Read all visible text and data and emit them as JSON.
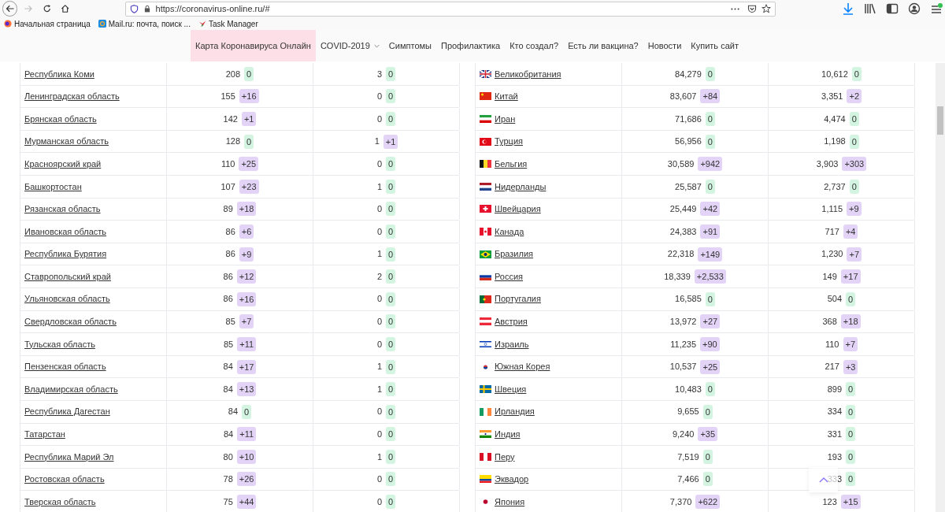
{
  "browser": {
    "url": "https://coronavirus-online.ru/#",
    "forward_disabled": true,
    "bookmarks": [
      "Начальная страница",
      "Mail.ru: почта, поиск ...",
      "Task Manager"
    ]
  },
  "nav": [
    {
      "label": "Карта Коронавируса Онлайн",
      "selected": true,
      "dropdown": false
    },
    {
      "label": "COVID-2019",
      "selected": false,
      "dropdown": true
    },
    {
      "label": "Симптомы",
      "selected": false,
      "dropdown": false
    },
    {
      "label": "Профилактика",
      "selected": false,
      "dropdown": false
    },
    {
      "label": "Кто создал?",
      "selected": false,
      "dropdown": false
    },
    {
      "label": "Есть ли вакцина?",
      "selected": false,
      "dropdown": false
    },
    {
      "label": "Новости",
      "selected": false,
      "dropdown": false
    },
    {
      "label": "Купить сайт",
      "selected": false,
      "dropdown": false
    }
  ],
  "tables": [
    {
      "rows": [
        {
          "name": "Республика Коми",
          "cases": {
            "value": "208",
            "delta": "0",
            "rising": false
          },
          "deaths": {
            "value": "3",
            "delta": "0",
            "rising": false
          }
        },
        {
          "name": "Ленинградская область",
          "cases": {
            "value": "155",
            "delta": "+16",
            "rising": true
          },
          "deaths": {
            "value": "0",
            "delta": "0",
            "rising": false
          }
        },
        {
          "name": "Брянская область",
          "cases": {
            "value": "142",
            "delta": "+1",
            "rising": true
          },
          "deaths": {
            "value": "0",
            "delta": "0",
            "rising": false
          }
        },
        {
          "name": "Мурманская область",
          "cases": {
            "value": "128",
            "delta": "0",
            "rising": false
          },
          "deaths": {
            "value": "1",
            "delta": "+1",
            "rising": true
          }
        },
        {
          "name": "Красноярский край",
          "cases": {
            "value": "110",
            "delta": "+25",
            "rising": true
          },
          "deaths": {
            "value": "0",
            "delta": "0",
            "rising": false
          }
        },
        {
          "name": "Башкортостан",
          "cases": {
            "value": "107",
            "delta": "+23",
            "rising": true
          },
          "deaths": {
            "value": "1",
            "delta": "0",
            "rising": false
          }
        },
        {
          "name": "Рязанская область",
          "cases": {
            "value": "89",
            "delta": "+18",
            "rising": true
          },
          "deaths": {
            "value": "0",
            "delta": "0",
            "rising": false
          }
        },
        {
          "name": "Ивановская область",
          "cases": {
            "value": "86",
            "delta": "+6",
            "rising": true
          },
          "deaths": {
            "value": "0",
            "delta": "0",
            "rising": false
          }
        },
        {
          "name": "Республика Бурятия",
          "cases": {
            "value": "86",
            "delta": "+9",
            "rising": true
          },
          "deaths": {
            "value": "1",
            "delta": "0",
            "rising": false
          }
        },
        {
          "name": "Ставропольский край",
          "cases": {
            "value": "86",
            "delta": "+12",
            "rising": true
          },
          "deaths": {
            "value": "2",
            "delta": "0",
            "rising": false
          }
        },
        {
          "name": "Ульяновская область",
          "cases": {
            "value": "86",
            "delta": "+16",
            "rising": true
          },
          "deaths": {
            "value": "0",
            "delta": "0",
            "rising": false
          }
        },
        {
          "name": "Свердловская область",
          "cases": {
            "value": "85",
            "delta": "+7",
            "rising": true
          },
          "deaths": {
            "value": "0",
            "delta": "0",
            "rising": false
          }
        },
        {
          "name": "Тульская область",
          "cases": {
            "value": "85",
            "delta": "+11",
            "rising": true
          },
          "deaths": {
            "value": "0",
            "delta": "0",
            "rising": false
          }
        },
        {
          "name": "Пензенская область",
          "cases": {
            "value": "84",
            "delta": "+17",
            "rising": true
          },
          "deaths": {
            "value": "1",
            "delta": "0",
            "rising": false
          }
        },
        {
          "name": "Владимирская область",
          "cases": {
            "value": "84",
            "delta": "+13",
            "rising": true
          },
          "deaths": {
            "value": "1",
            "delta": "0",
            "rising": false
          }
        },
        {
          "name": "Республика Дагестан",
          "cases": {
            "value": "84",
            "delta": "0",
            "rising": false
          },
          "deaths": {
            "value": "0",
            "delta": "0",
            "rising": false
          }
        },
        {
          "name": "Татарстан",
          "cases": {
            "value": "84",
            "delta": "+11",
            "rising": true
          },
          "deaths": {
            "value": "0",
            "delta": "0",
            "rising": false
          }
        },
        {
          "name": "Республика Марий Эл",
          "cases": {
            "value": "80",
            "delta": "+10",
            "rising": true
          },
          "deaths": {
            "value": "1",
            "delta": "0",
            "rising": false
          }
        },
        {
          "name": "Ростовская область",
          "cases": {
            "value": "78",
            "delta": "+26",
            "rising": true
          },
          "deaths": {
            "value": "0",
            "delta": "0",
            "rising": false
          }
        },
        {
          "name": "Тверская область",
          "cases": {
            "value": "75",
            "delta": "+44",
            "rising": true
          },
          "deaths": {
            "value": "0",
            "delta": "0",
            "rising": false
          }
        }
      ]
    },
    {
      "rows": [
        {
          "name": "Великобритания",
          "cases": {
            "value": "84,279",
            "delta": "0",
            "rising": false
          },
          "deaths": {
            "value": "10,612",
            "delta": "0",
            "rising": false
          }
        },
        {
          "name": "Китай",
          "cases": {
            "value": "83,607",
            "delta": "+84",
            "rising": true
          },
          "deaths": {
            "value": "3,351",
            "delta": "+2",
            "rising": true
          }
        },
        {
          "name": "Иран",
          "cases": {
            "value": "71,686",
            "delta": "0",
            "rising": false
          },
          "deaths": {
            "value": "4,474",
            "delta": "0",
            "rising": false
          }
        },
        {
          "name": "Турция",
          "cases": {
            "value": "56,956",
            "delta": "0",
            "rising": false
          },
          "deaths": {
            "value": "1,198",
            "delta": "0",
            "rising": false
          }
        },
        {
          "name": "Бельгия",
          "cases": {
            "value": "30,589",
            "delta": "+942",
            "rising": true
          },
          "deaths": {
            "value": "3,903",
            "delta": "+303",
            "rising": true
          }
        },
        {
          "name": "Нидерланды",
          "cases": {
            "value": "25,587",
            "delta": "0",
            "rising": false
          },
          "deaths": {
            "value": "2,737",
            "delta": "0",
            "rising": false
          }
        },
        {
          "name": "Швейцария",
          "cases": {
            "value": "25,449",
            "delta": "+42",
            "rising": true
          },
          "deaths": {
            "value": "1,115",
            "delta": "+9",
            "rising": true
          }
        },
        {
          "name": "Канада",
          "cases": {
            "value": "24,383",
            "delta": "+91",
            "rising": true
          },
          "deaths": {
            "value": "717",
            "delta": "+4",
            "rising": true
          }
        },
        {
          "name": "Бразилия",
          "cases": {
            "value": "22,318",
            "delta": "+149",
            "rising": true
          },
          "deaths": {
            "value": "1,230",
            "delta": "+7",
            "rising": true
          }
        },
        {
          "name": "Россия",
          "cases": {
            "value": "18,339",
            "delta": "+2,533",
            "rising": true
          },
          "deaths": {
            "value": "149",
            "delta": "+17",
            "rising": true
          }
        },
        {
          "name": "Португалия",
          "cases": {
            "value": "16,585",
            "delta": "0",
            "rising": false
          },
          "deaths": {
            "value": "504",
            "delta": "0",
            "rising": false
          }
        },
        {
          "name": "Австрия",
          "cases": {
            "value": "13,972",
            "delta": "+27",
            "rising": true
          },
          "deaths": {
            "value": "368",
            "delta": "+18",
            "rising": true
          }
        },
        {
          "name": "Израиль",
          "cases": {
            "value": "11,235",
            "delta": "+90",
            "rising": true
          },
          "deaths": {
            "value": "110",
            "delta": "+7",
            "rising": true
          }
        },
        {
          "name": "Южная Корея",
          "cases": {
            "value": "10,537",
            "delta": "+25",
            "rising": true
          },
          "deaths": {
            "value": "217",
            "delta": "+3",
            "rising": true
          }
        },
        {
          "name": "Швеция",
          "cases": {
            "value": "10,483",
            "delta": "0",
            "rising": false
          },
          "deaths": {
            "value": "899",
            "delta": "0",
            "rising": false
          }
        },
        {
          "name": "Ирландия",
          "cases": {
            "value": "9,655",
            "delta": "0",
            "rising": false
          },
          "deaths": {
            "value": "334",
            "delta": "0",
            "rising": false
          }
        },
        {
          "name": "Индия",
          "cases": {
            "value": "9,240",
            "delta": "+35",
            "rising": true
          },
          "deaths": {
            "value": "331",
            "delta": "0",
            "rising": false
          }
        },
        {
          "name": "Перу",
          "cases": {
            "value": "7,519",
            "delta": "0",
            "rising": false
          },
          "deaths": {
            "value": "193",
            "delta": "0",
            "rising": false
          }
        },
        {
          "name": "Эквадор",
          "cases": {
            "value": "7,466",
            "delta": "0",
            "rising": false
          },
          "deaths": {
            "value": "333",
            "delta": "0",
            "rising": false
          }
        },
        {
          "name": "Япония",
          "cases": {
            "value": "7,370",
            "delta": "+622",
            "rising": true
          },
          "deaths": {
            "value": "123",
            "delta": "+15",
            "rising": true
          }
        }
      ]
    }
  ]
}
